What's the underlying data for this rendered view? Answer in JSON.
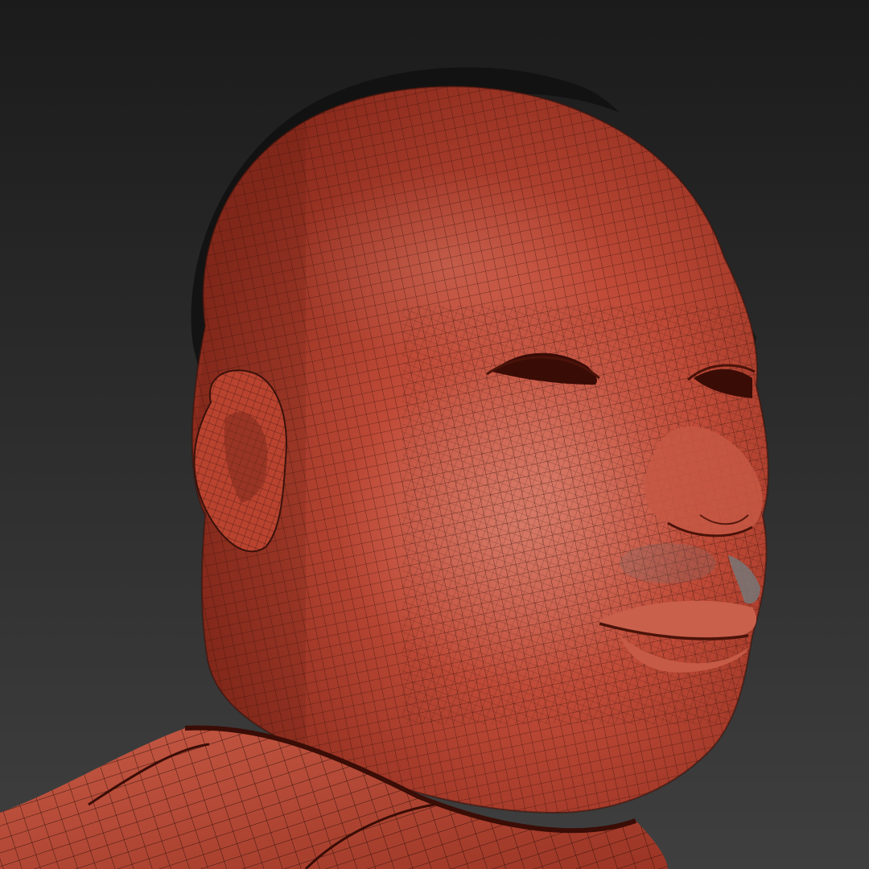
{
  "scene": {
    "subject": "3d-head-wireframe-render",
    "colors": {
      "background_top": "#1b1b1b",
      "background_bottom": "#3d3d3d",
      "skin_base": "#b8402f",
      "skin_highlight": "#d86a55",
      "skin_shadow": "#7a2418",
      "wire": "#2a0e09",
      "hair": "#121212",
      "mustache": "#6f6f6f"
    }
  }
}
